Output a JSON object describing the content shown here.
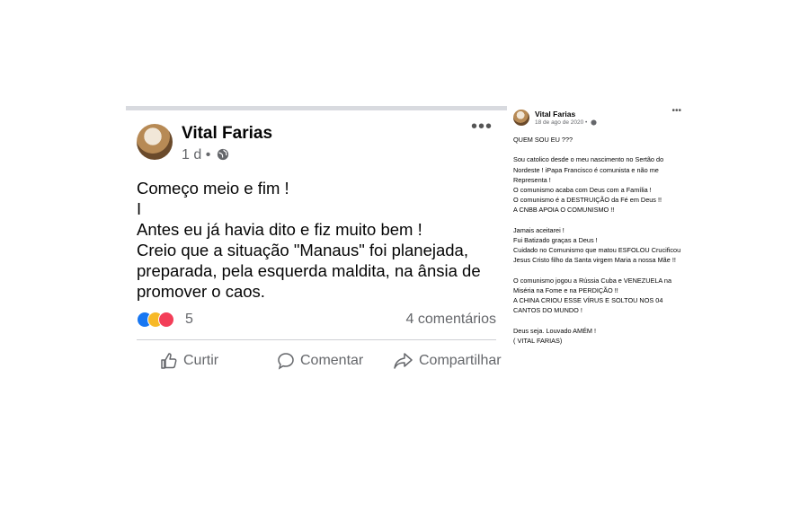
{
  "left_post": {
    "author": "Vital Farias",
    "meta": "1 d •",
    "icons": [
      "globe-icon",
      "more-options-icon",
      "like-reaction-icon",
      "haha-reaction-icon",
      "love-reaction-icon",
      "thumbs-up-icon",
      "comment-icon",
      "share-icon"
    ],
    "text": "Começo meio e fim !\n                    I\nAntes eu já havia dito e fiz muito bem !\nCreio que a situação \"Manaus\" foi planejada, preparada, pela esquerda maldita, na ânsia  de promover o caos.",
    "reaction_count": "5",
    "comments": "4 comentários",
    "actions": {
      "like": "Curtir",
      "comment": "Comentar",
      "share": "Compartilhar"
    }
  },
  "right_post": {
    "author": "Vital Farias",
    "date": "18 de ago de 2020 •",
    "text": "QUEM SOU EU ???\n\nSou catolico desde o meu nascimento  no Sertão do Nordeste !  iPapa Francisco é comunista e não me Representa !\nO comunismo acaba com Deus com a Família !\nO comunismo é a DESTRUIÇÃO da Fé em Deus !!\nA CNBB APOIA O COMUNISMO !!\n\nJamais aceitarei !\n Fui Batizado graças a Deus !\n Cuidado no Comunismo que matou ESFOLOU Crucificou Jesus Cristo filho da Santa  virgem Maria a nossa Mãe !!\n\nO comunismo  jogou a Rússia Cuba e VENEZUELA na Miséria na Fome e na PERDIÇÃO !!\nA CHINA CRIOU ESSE VÍRUS E SOLTOU NOS 04 CANTOS DO MUNDO !\n\n Deus seja. Louvado AMÉM !\n( VITAL FARIAS)"
  },
  "colors": {
    "secondary_text": "#65676b",
    "like_blue": "#1877f2",
    "haha_yellow": "#f7b928",
    "love_red": "#f33e58"
  }
}
